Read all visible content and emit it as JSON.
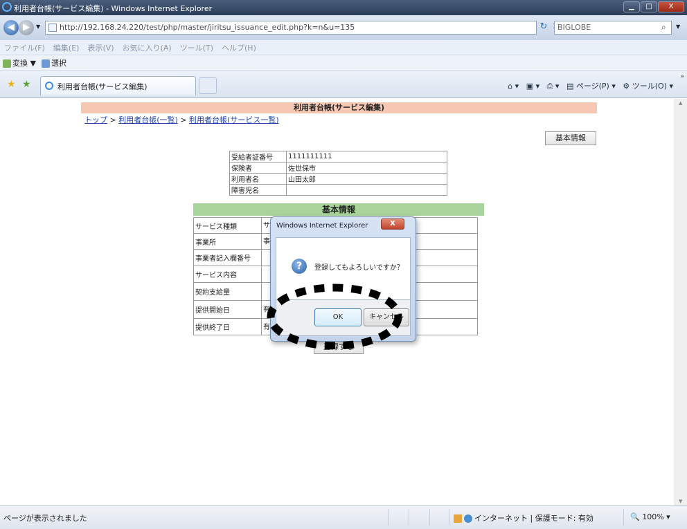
{
  "window": {
    "title": "利用者台帳(サービス編集) - Windows Internet Explorer",
    "min": "▁",
    "max": "□",
    "close": "X"
  },
  "address": {
    "url": "http://192.168.24.220/test/php/master/jiritsu_issuance_edit.php?k=n&u=135",
    "search_placeholder": "BIGLOBE"
  },
  "menu": [
    "ファイル(F)",
    "編集(E)",
    "表示(V)",
    "お気に入り(A)",
    "ツール(T)",
    "ヘルプ(H)"
  ],
  "favbar": {
    "convert": "変換",
    "select": "選択"
  },
  "tab": {
    "label": "利用者台帳(サービス編集)"
  },
  "commandbar": {
    "page": "ページ(P)",
    "tools": "ツール(O)"
  },
  "page": {
    "header": "利用者台帳(サービス編集)",
    "breadcrumb": {
      "top": "トップ",
      "sep": ">",
      "list": "利用者台帳(一覧)",
      "service_list": "利用者台帳(サービス一覧)"
    },
    "kihon_button": "基本情報",
    "info_rows": [
      {
        "label": "受給者証番号",
        "value": "1111111111"
      },
      {
        "label": "保険者",
        "value": "佐世保市"
      },
      {
        "label": "利用者名",
        "value": "山田太郎"
      },
      {
        "label": "障害児名",
        "value": ""
      }
    ],
    "section_header": "基本情報",
    "form_rows": [
      {
        "label": "サービス種類",
        "value": "サ"
      },
      {
        "label": "事業所",
        "value": "事"
      },
      {
        "label": "事業者記入欄番号",
        "value": ""
      },
      {
        "label": "サービス内容",
        "value": ""
      },
      {
        "label": "契約支給量",
        "value": ""
      },
      {
        "label": "提供開始日",
        "value": "有"
      },
      {
        "label": "提供終了日",
        "value": "有"
      }
    ],
    "register_button": "登録する"
  },
  "dialog": {
    "title": "Windows Internet Explorer",
    "message": "登録してもよろしいですか？",
    "ok": "OK",
    "cancel": "キャンセル",
    "close": "X"
  },
  "status": {
    "text": "ページが表示されました",
    "zone": "インターネット | 保護モード: 有効",
    "zoom": "100%"
  }
}
